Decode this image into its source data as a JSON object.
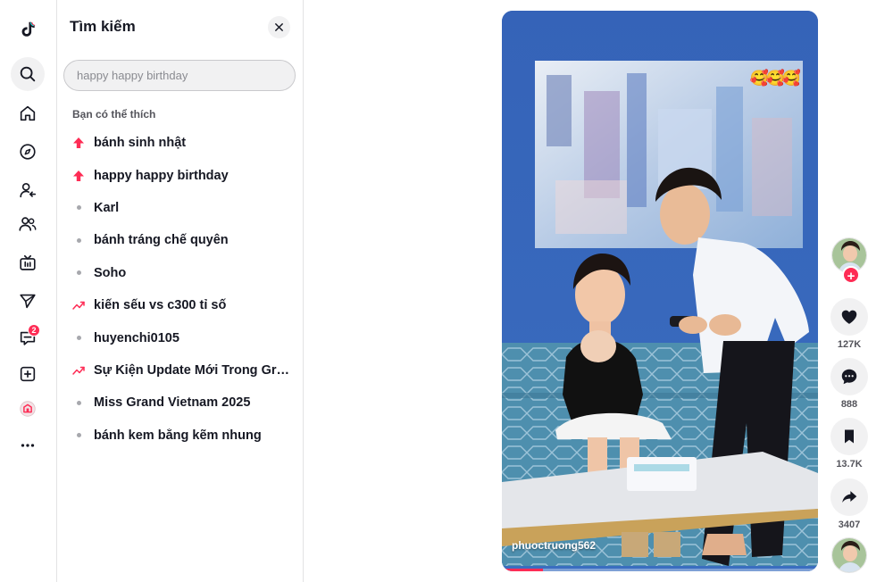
{
  "sidebar": {
    "items": [
      {
        "name": "search"
      },
      {
        "name": "home"
      },
      {
        "name": "explore"
      },
      {
        "name": "following"
      },
      {
        "name": "friends"
      },
      {
        "name": "live"
      },
      {
        "name": "messages"
      },
      {
        "name": "activity",
        "badge": "2"
      },
      {
        "name": "upload"
      },
      {
        "name": "profile"
      },
      {
        "name": "more"
      }
    ]
  },
  "search_panel": {
    "title": "Tìm kiếm",
    "input_value": "happy happy birthday",
    "suggest_heading": "Bạn có thể thích",
    "suggestions": [
      {
        "label": "bánh sinh nhật",
        "icon": "hot-arrow-icon"
      },
      {
        "label": "happy happy birthday",
        "icon": "hot-arrow-icon"
      },
      {
        "label": "Karl",
        "icon": "dot"
      },
      {
        "label": "bánh tráng chế quyên",
        "icon": "dot"
      },
      {
        "label": "Soho",
        "icon": "dot"
      },
      {
        "label": "kiến sếu vs c300 tỉ số",
        "icon": "trending-icon"
      },
      {
        "label": "huyenchi0105",
        "icon": "dot"
      },
      {
        "label": "Sự Kiện Update Mới Trong Gro...",
        "icon": "trending-icon"
      },
      {
        "label": "Miss Grand Vietnam 2025",
        "icon": "dot"
      },
      {
        "label": "bánh kem bằng kẽm nhung",
        "icon": "dot"
      }
    ]
  },
  "video": {
    "username": "phuoctruong562",
    "emojis": "🥰🥰🥰",
    "progress": 0.13
  },
  "actions": {
    "likes": "127K",
    "comments": "888",
    "saves": "13.7K",
    "shares": "3407"
  },
  "colors": {
    "accent": "#fe2c55",
    "hot_arrow": "#fe2c55",
    "wall": "#3a67b4",
    "sofa": "#4d8aa8"
  }
}
